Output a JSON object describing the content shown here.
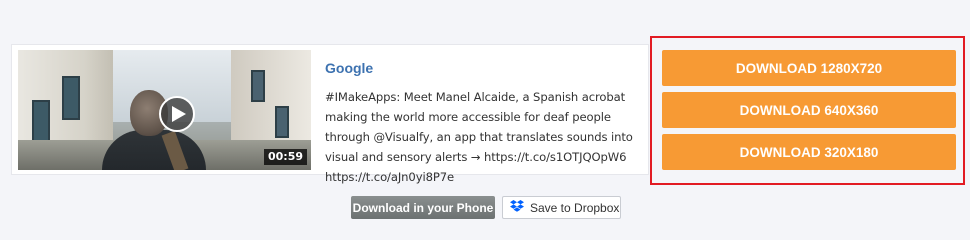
{
  "video": {
    "duration": "00:59",
    "author": "Google",
    "description": "#IMakeApps: Meet Manel Alcaide, a Spanish acrobat making the world more accessible for deaf people through @Visualfy, an app that translates sounds into visual and sensory alerts → https://t.co/s1OTJQOpW6 https://t.co/aJn0yi8P7e"
  },
  "downloads": {
    "buttons": [
      {
        "label": "DOWNLOAD 1280X720"
      },
      {
        "label": "DOWNLOAD 640X360"
      },
      {
        "label": "DOWNLOAD 320X180"
      }
    ]
  },
  "actions": {
    "phone_label": "Download in your Phone",
    "dropbox_label": "Save to Dropbox"
  },
  "colors": {
    "accent_orange": "#f79a34",
    "highlight_red": "#e21b23",
    "link_blue": "#3d72b0",
    "dropbox_blue": "#0061ff"
  },
  "icons": {
    "play": "play-icon",
    "dropbox": "dropbox-icon"
  }
}
